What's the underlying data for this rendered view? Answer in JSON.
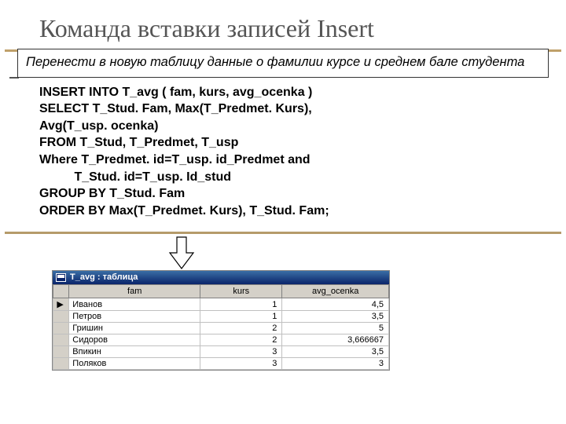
{
  "title": "Команда вставки записей Insert",
  "task": "Перенести в новую таблицу данные о фамилии курсе и среднем бале студента",
  "sql": "INSERT INTO T_avg ( fam, kurs, avg_ocenka )\nSELECT T_Stud. Fam, Max(T_Predmet. Kurs),\nAvg(T_usp. ocenka)\nFROM T_Stud, T_Predmet, T_usp\nWhere T_Predmet. id=T_usp. id_Predmet and\n          T_Stud. id=T_usp. Id_stud\nGROUP BY T_Stud. Fam\nORDER BY Max(T_Predmet. Kurs), T_Stud. Fam;",
  "table": {
    "title": "T_avg : таблица",
    "columns": [
      "fam",
      "kurs",
      "avg_ocenka"
    ],
    "rows": [
      {
        "fam": "Иванов",
        "kurs": "1",
        "avg": "4,5"
      },
      {
        "fam": "Петров",
        "kurs": "1",
        "avg": "3,5"
      },
      {
        "fam": "Гришин",
        "kurs": "2",
        "avg": "5"
      },
      {
        "fam": "Сидоров",
        "kurs": "2",
        "avg": "3,666667"
      },
      {
        "fam": "Впикин",
        "kurs": "3",
        "avg": "3,5"
      },
      {
        "fam": "Поляков",
        "kurs": "3",
        "avg": "3"
      }
    ]
  }
}
